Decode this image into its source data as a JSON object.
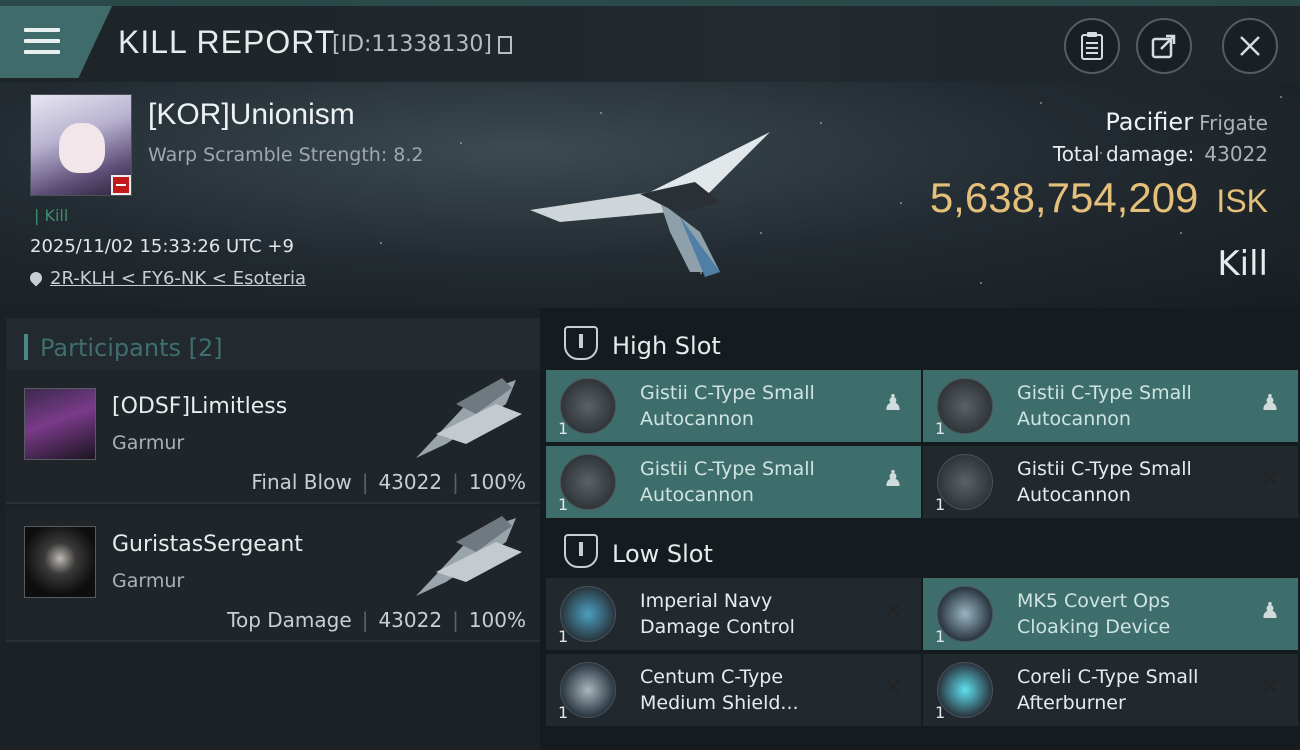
{
  "header": {
    "title": "KILL REPORT",
    "report_id": "[ID:11338130]",
    "buttons": [
      {
        "name": "clipboard-button",
        "icon": "clipboard-icon"
      },
      {
        "name": "share-button",
        "icon": "share-icon"
      },
      {
        "name": "close-button",
        "icon": "close-icon"
      }
    ]
  },
  "victim": {
    "name": "[KOR]Unionism",
    "warp_scramble": "Warp Scramble Strength: 8.2",
    "status": "Kill",
    "datetime": "2025/11/02 15:33:26 UTC +9",
    "location": "2R-KLH < FY6-NK < Esoteria",
    "ship_name": "Pacifier",
    "ship_class": "Frigate",
    "total_damage_label": "Total damage:",
    "total_damage": "43022",
    "isk_value": "5,638,754,209",
    "isk_unit": "ISK",
    "result": "Kill"
  },
  "participants": {
    "label": "Participants",
    "count": "[2]",
    "rows": [
      {
        "name": "[ODSF]Limitless",
        "ship": "Garmur",
        "role": "Final Blow",
        "damage": "43022",
        "percent": "100%"
      },
      {
        "name": "GuristasSergeant",
        "ship": "Garmur",
        "role": "Top Damage",
        "damage": "43022",
        "percent": "100%"
      }
    ]
  },
  "high_slot": {
    "label": "High Slot",
    "modules": [
      {
        "name_line1": "Gistii C-Type Small",
        "name_line2": "Autocannon",
        "qty": "1",
        "state": "dropped"
      },
      {
        "name_line1": "Gistii C-Type Small",
        "name_line2": "Autocannon",
        "qty": "1",
        "state": "dropped"
      },
      {
        "name_line1": "Gistii C-Type Small",
        "name_line2": "Autocannon",
        "qty": "1",
        "state": "dropped"
      },
      {
        "name_line1": "Gistii C-Type Small",
        "name_line2": "Autocannon",
        "qty": "1",
        "state": "destroyed"
      }
    ]
  },
  "low_slot": {
    "label": "Low Slot",
    "modules": [
      {
        "name_line1": "Imperial Navy",
        "name_line2": "Damage Control",
        "qty": "1",
        "state": "destroyed"
      },
      {
        "name_line1": "MK5 Covert Ops",
        "name_line2": "Cloaking Device",
        "qty": "1",
        "state": "dropped"
      },
      {
        "name_line1": "Centum C-Type",
        "name_line2": "Medium Shield...",
        "qty": "1",
        "state": "destroyed"
      },
      {
        "name_line1": "Coreli C-Type Small",
        "name_line2": "Afterburner",
        "qty": "1",
        "state": "destroyed"
      }
    ]
  },
  "colors": {
    "accent": "#3d6e6b",
    "isk": "#e4c07a",
    "kill_tag": "#3c8f6a"
  }
}
